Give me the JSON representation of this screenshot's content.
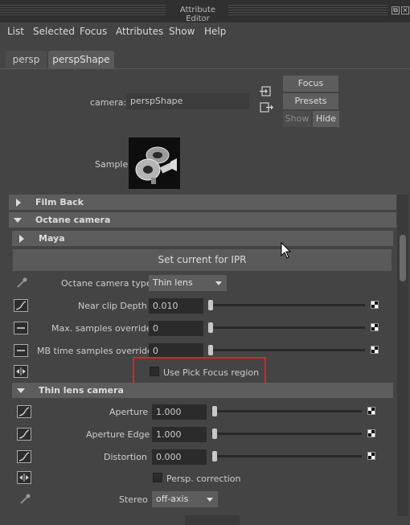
{
  "window": {
    "title": "Attribute Editor"
  },
  "menu": [
    "List",
    "Selected",
    "Focus",
    "Attributes",
    "Show",
    "Help"
  ],
  "tabs": [
    {
      "label": "persp",
      "active": false
    },
    {
      "label": "perspShape",
      "active": true
    }
  ],
  "header": {
    "camera_label": "camera:",
    "camera_value": "perspShape",
    "focus_button": "Focus",
    "presets_button": "Presets",
    "show_button": "Show",
    "hide_button": "Hide",
    "sample_label": "Sample"
  },
  "sections": {
    "film_back": "Film Back",
    "octane_camera": "Octane camera",
    "maya": "Maya",
    "thin_lens": "Thin lens camera"
  },
  "set_current_button": "Set current for IPR",
  "octane_attrs": {
    "camera_type_label": "Octane camera type",
    "camera_type_value": "Thin lens",
    "near_clip_label": "Near clip Depth",
    "near_clip_value": "0.010",
    "near_clip_fraction": 0,
    "max_samples_label": "Max. samples override",
    "max_samples_value": "0",
    "max_samples_fraction": 0,
    "mb_time_label": "MB time samples override",
    "mb_time_value": "0",
    "mb_time_fraction": 0,
    "pick_focus_label": "Use Pick Focus region",
    "pick_focus_checked": false
  },
  "thin_lens_attrs": {
    "aperture_label": "Aperture",
    "aperture_value": "1.000",
    "aperture_edge_label": "Aperture Edge",
    "aperture_edge_value": "1.000",
    "distortion_label": "Distortion",
    "distortion_value": "0.000",
    "persp_correction_label": "Persp. correction",
    "persp_correction_checked": false,
    "stereo_label": "Stereo",
    "stereo_value": "off-axis"
  },
  "colors": {
    "highlight_box": "#d9232a",
    "background": "#444444",
    "field_bg": "#2b2b2b",
    "section_bg": "#5d5d5d"
  }
}
